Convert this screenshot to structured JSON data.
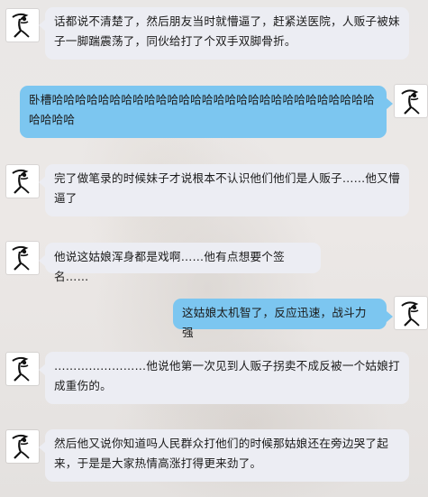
{
  "messages": [
    {
      "side": "in",
      "text": "话都说不清楚了，然后朋友当时就懵逼了，赶紧送医院，人贩子被妹子一脚踹震荡了，同伙给打了个双手双脚骨折。"
    },
    {
      "side": "out",
      "text": "卧槽哈哈哈哈哈哈哈哈哈哈哈哈哈哈哈哈哈哈哈哈哈哈哈哈哈哈哈哈哈哈哈哈"
    },
    {
      "side": "in",
      "text": "完了做笔录的时候妹子才说根本不认识他们他们是人贩子……他又懵逼了"
    },
    {
      "side": "in",
      "text": "他说这姑娘浑身都是戏啊……他有点想要个签名……"
    },
    {
      "side": "out",
      "text": "这姑娘太机智了，反应迅速，战斗力强"
    },
    {
      "side": "in",
      "text": "……………………他说他第一次见到人贩子拐卖不成反被一个姑娘打成重伤的。"
    },
    {
      "side": "in",
      "text": "然后他又说你知道吗人民群众打他们的时候那姑娘还在旁边哭了起来，于是是大家热情高涨打得更来劲了。"
    }
  ],
  "avatar_icon": "sketch-figure-avatar-icon",
  "colors": {
    "incoming_bubble": "#ecedf3",
    "outgoing_bubble": "#7cc6f0",
    "background": "#e9e7e6"
  }
}
